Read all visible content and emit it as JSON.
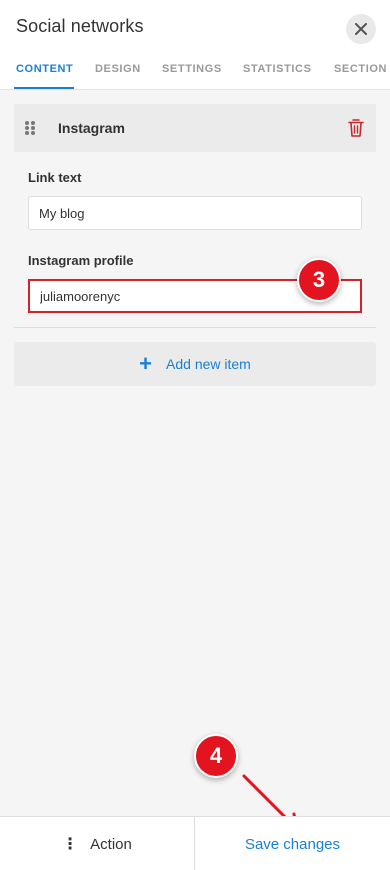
{
  "header": {
    "title": "Social networks",
    "close_icon": "close-icon"
  },
  "tabs": [
    {
      "label": "CONTENT",
      "active": true
    },
    {
      "label": "DESIGN",
      "active": false
    },
    {
      "label": "SETTINGS",
      "active": false
    },
    {
      "label": "STATISTICS",
      "active": false
    },
    {
      "label": "SECTION",
      "active": false
    }
  ],
  "item": {
    "title": "Instagram",
    "drag_icon": "drag-handle-icon",
    "delete_icon": "trash-icon",
    "fields": [
      {
        "label": "Link text",
        "value": "My blog"
      },
      {
        "label": "Instagram profile",
        "value": "juliamoorenyc"
      }
    ]
  },
  "add_item": {
    "label": "Add new item",
    "icon": "plus-icon"
  },
  "annotations": {
    "step3": "3",
    "step4": "4"
  },
  "footer": {
    "action_label": "Action",
    "save_label": "Save changes"
  },
  "colors": {
    "accent": "#1a7fd6",
    "danger": "#c62828",
    "marker": "#e3141f"
  }
}
